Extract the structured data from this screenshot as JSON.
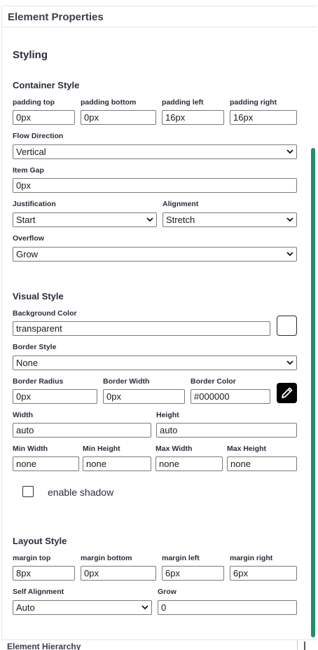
{
  "panel": {
    "title": "Element Properties"
  },
  "styling_title": "Styling",
  "container_style": {
    "title": "Container Style",
    "padding_top": {
      "label": "padding top",
      "value": "0px"
    },
    "padding_bottom": {
      "label": "padding bottom",
      "value": "0px"
    },
    "padding_left": {
      "label": "padding left",
      "value": "16px"
    },
    "padding_right": {
      "label": "padding right",
      "value": "16px"
    },
    "flow_direction": {
      "label": "Flow Direction",
      "value": "Vertical"
    },
    "item_gap": {
      "label": "Item Gap",
      "value": "0px"
    },
    "justification": {
      "label": "Justification",
      "value": "Start"
    },
    "alignment": {
      "label": "Alignment",
      "value": "Stretch"
    },
    "overflow": {
      "label": "Overflow",
      "value": "Grow"
    }
  },
  "visual_style": {
    "title": "Visual Style",
    "background_color": {
      "label": "Background Color",
      "value": "transparent"
    },
    "border_style": {
      "label": "Border Style",
      "value": "None"
    },
    "border_radius": {
      "label": "Border Radius",
      "value": "0px"
    },
    "border_width": {
      "label": "Border Width",
      "value": "0px"
    },
    "border_color": {
      "label": "Border Color",
      "value": "#000000"
    },
    "width": {
      "label": "Width",
      "value": "auto"
    },
    "height": {
      "label": "Height",
      "value": "auto"
    },
    "min_width": {
      "label": "Min Width",
      "value": "none"
    },
    "min_height": {
      "label": "Min Height",
      "value": "none"
    },
    "max_width": {
      "label": "Max Width",
      "value": "none"
    },
    "max_height": {
      "label": "Max Height",
      "value": "none"
    },
    "enable_shadow": {
      "label": "enable shadow",
      "checked": false
    }
  },
  "layout_style": {
    "title": "Layout Style",
    "margin_top": {
      "label": "margin top",
      "value": "8px"
    },
    "margin_bottom": {
      "label": "margin bottom",
      "value": "0px"
    },
    "margin_left": {
      "label": "margin left",
      "value": "6px"
    },
    "margin_right": {
      "label": "margin right",
      "value": "6px"
    },
    "self_alignment": {
      "label": "Self Alignment",
      "value": "Auto"
    },
    "grow": {
      "label": "Grow",
      "value": "0"
    }
  },
  "footer": {
    "label": "Element Hierarchy"
  },
  "colors": {
    "scrollbar": "#1f8f6f",
    "pencil_button_bg": "#000000"
  },
  "icons": {
    "chevron": "chevron-down-icon",
    "edit": "pencil-icon",
    "add": "plus-icon"
  }
}
